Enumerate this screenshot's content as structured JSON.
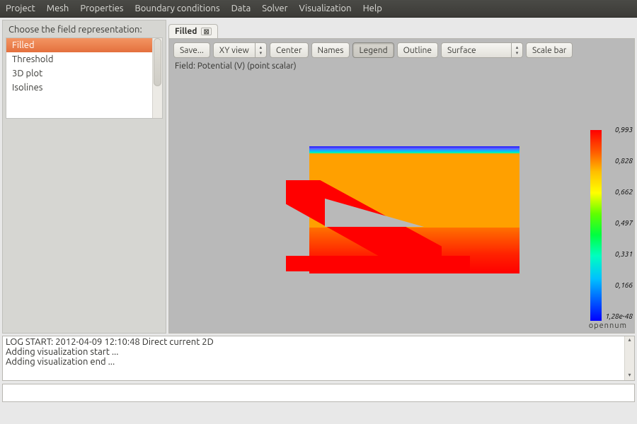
{
  "menu": {
    "items": [
      "Project",
      "Mesh",
      "Properties",
      "Boundary conditions",
      "Data",
      "Solver",
      "Visualization",
      "Help"
    ]
  },
  "sidebar": {
    "title": "Choose the field representation:",
    "items": [
      "Filled",
      "Threshold",
      "3D plot",
      "Isolines"
    ],
    "selected_index": 0
  },
  "tab": {
    "label": "Filled"
  },
  "toolbar": {
    "save": "Save...",
    "xyview": "XY view",
    "center": "Center",
    "names": "Names",
    "legend": "Legend",
    "outline": "Outline",
    "surface_mode": "Surface",
    "scalebar": "Scale bar"
  },
  "field_line": "Field:  Potential (V) (point scalar)",
  "colorbar": {
    "labels": [
      "0,993",
      "0,828",
      "0,662",
      "0,497",
      "0,331",
      "0,166",
      "1,28e-48"
    ]
  },
  "brand": "opennum",
  "log": {
    "lines": [
      "LOG START: 2012-04-09 12:10:48 Direct current 2D",
      "Adding visualization start ...",
      "Adding visualization end ..."
    ]
  },
  "chart_data": {
    "type": "heatmap",
    "title": "Potential (V) (point scalar)",
    "value_range": [
      1.28e-48,
      0.993
    ],
    "colorbar_ticks": [
      0.993,
      0.828,
      0.662,
      0.497,
      0.331,
      0.166,
      1.28e-48
    ],
    "colormap": "jet",
    "note": "2D filled scalar field on irregular domain; values rendered via color only (no numeric grid readable)"
  }
}
